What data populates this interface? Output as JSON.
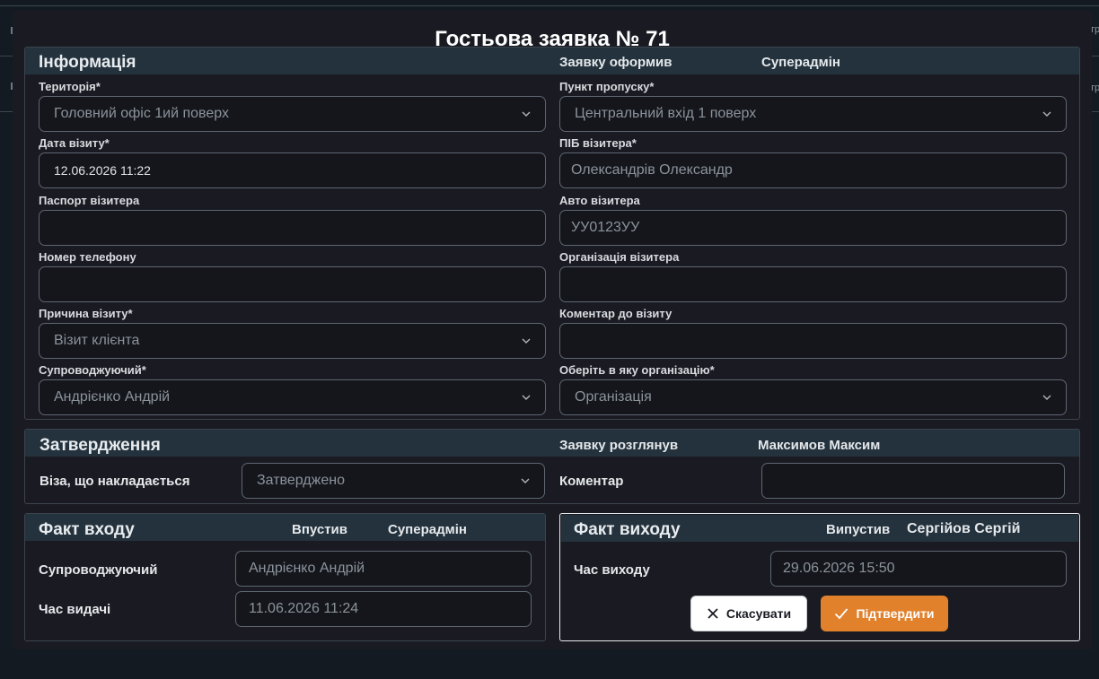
{
  "modal": {
    "title": "Гостьова заявка № 71"
  },
  "info": {
    "title": "Інформація",
    "created_by_label": "Заявку оформив",
    "created_by_value": "Супeрадмін",
    "fields": {
      "territory": {
        "label": "Територія*",
        "value": "Головний офіс  1ий поверх"
      },
      "checkpoint": {
        "label": "Пункт пропуску*",
        "value": "Центральний вхід 1 поверх"
      },
      "visit_date": {
        "label": "Дата візиту*",
        "value": "12.06.2026 11:22"
      },
      "visitor_name": {
        "label": "ПІБ візитера*",
        "value": "Олександрів Олександр"
      },
      "passport": {
        "label": "Паспорт візитера",
        "value": ""
      },
      "car": {
        "label": "Авто візитера",
        "value": "УУ0123УУ"
      },
      "phone": {
        "label": "Номер телефону",
        "value": ""
      },
      "visitor_org": {
        "label": "Організація візитера",
        "value": ""
      },
      "reason": {
        "label": "Причина візиту*",
        "value": "Візит клієнта"
      },
      "comment": {
        "label": "Коментар до візиту",
        "value": ""
      },
      "escort": {
        "label": "Супроводжуючий*",
        "value": "Андрієнко Андрій"
      },
      "target_org": {
        "label": "Оберіть в яку організацію*",
        "value": "Організація"
      }
    }
  },
  "approval": {
    "title": "Затвердження",
    "reviewed_label": "Заявку розглянув",
    "reviewed_value": "Максимов Максим",
    "visa_label": "Віза, що накладається",
    "visa_value": "Затверджено",
    "comment_label": "Коментар",
    "comment_value": ""
  },
  "entry": {
    "title": "Факт входу",
    "admitted_label": "Впустив",
    "admitted_value": "Супeрадмін",
    "escort_label": "Супроводжуючий",
    "escort_value": "Андрієнко Андрій",
    "issue_time_label": "Час видачі",
    "issue_time_value": "11.06.2026 11:24"
  },
  "exit": {
    "title": "Факт виходу",
    "released_label": "Випустив",
    "released_value": "Сергійов Сергій",
    "exit_time_label": "Час виходу",
    "exit_time_value": "29.06.2026 15:50",
    "cancel_label": "Скасувати",
    "confirm_label": "Підтвердити"
  },
  "background": {
    "right_tick_1": "тр",
    "right_tick_2": "тр"
  },
  "colors": {
    "accent": "#e1812c",
    "section_header": "#24323d",
    "modal_bg": "#1a1b22"
  },
  "icons": [
    "chevron-down-icon",
    "close-icon",
    "check-icon"
  ]
}
